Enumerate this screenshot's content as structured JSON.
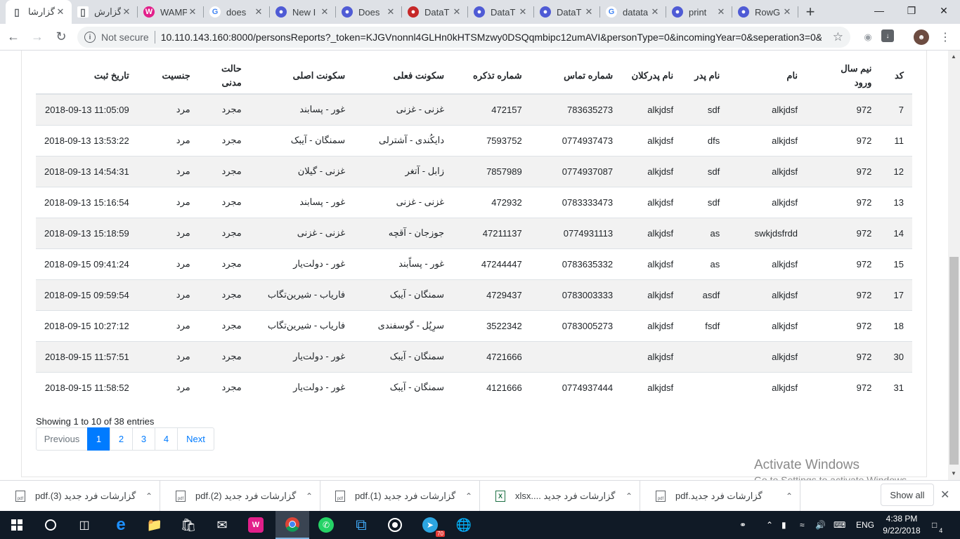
{
  "browser": {
    "tabs": [
      {
        "title": "گزارشا",
        "icon": "page-icon",
        "active": true
      },
      {
        "title": "گزارش",
        "icon": "page-icon"
      },
      {
        "title": "WAMP",
        "icon": "wamp-icon"
      },
      {
        "title": "does",
        "icon": "google-icon"
      },
      {
        "title": "New I",
        "icon": "globe-icon"
      },
      {
        "title": "Does",
        "icon": "globe-icon"
      },
      {
        "title": "DataT",
        "icon": "datatables-icon"
      },
      {
        "title": "DataT",
        "icon": "globe-icon"
      },
      {
        "title": "DataT",
        "icon": "globe-icon"
      },
      {
        "title": "datata",
        "icon": "google-icon"
      },
      {
        "title": "print",
        "icon": "globe-icon"
      },
      {
        "title": "RowG",
        "icon": "globe-icon"
      }
    ],
    "not_secure": "Not secure",
    "url": "10.110.143.160:8000/personsReports?_token=KJGVnonnl4GLHn0kHTSMzwy0DSQqmbipc12umAVI&personType=0&incomingYear=0&seperation3=0&..."
  },
  "table": {
    "headers": {
      "code": "کد",
      "entry_half_line1": "نیم سال",
      "entry_half_line2": "ورود",
      "name": "نام",
      "father": "نام پدر",
      "grandfather": "نام پدرکلان",
      "phone": "شماره تماس",
      "tazkira": "شماره تذکره",
      "current_res": "سکونت فعلی",
      "original_res": "سکونت اصلی",
      "marital_line1": "حالت",
      "marital_line2": "مدنی",
      "gender": "جنسیت",
      "reg_date": "تاریخ ثبت"
    },
    "rows": [
      {
        "code": "7",
        "half": "972",
        "name": "alkjdsf",
        "father": "sdf",
        "grandfather": "alkjdsf",
        "phone": "783635273",
        "tazkira": "472157",
        "current": "غزنی - غزنی",
        "original": "غور - پسابند",
        "marital": "مجرد",
        "gender": "مرد",
        "date": "2018-09-13 11:05:09"
      },
      {
        "code": "11",
        "half": "972",
        "name": "alkjdsf",
        "father": "dfs",
        "grandfather": "alkjdsf",
        "phone": "0774937473",
        "tazkira": "7593752",
        "current": "دایکُندی - آشترلی",
        "original": "سمنگان - آیبک",
        "marital": "مجرد",
        "gender": "مرد",
        "date": "2018-09-13 13:53:22"
      },
      {
        "code": "12",
        "half": "972",
        "name": "alkjdsf",
        "father": "sdf",
        "grandfather": "alkjdsf",
        "phone": "0774937087",
        "tazkira": "7857989",
        "current": "زابل - آتغر",
        "original": "غزنی - گیلان",
        "marital": "مجرد",
        "gender": "مرد",
        "date": "2018-09-13 14:54:31"
      },
      {
        "code": "13",
        "half": "972",
        "name": "alkjdsf",
        "father": "sdf",
        "grandfather": "alkjdsf",
        "phone": "0783333473",
        "tazkira": "472932",
        "current": "غزنی - غزنی",
        "original": "غور - پسابند",
        "marital": "مجرد",
        "gender": "مرد",
        "date": "2018-09-13 15:16:54"
      },
      {
        "code": "14",
        "half": "972",
        "name": "swkjdsfrdd",
        "father": "as",
        "grandfather": "alkjdsf",
        "phone": "0774931113",
        "tazkira": "47211137",
        "current": "جوزجان - آقچه",
        "original": "غزنی - غزنی",
        "marital": "مجرد",
        "gender": "مرد",
        "date": "2018-09-13 15:18:59"
      },
      {
        "code": "15",
        "half": "972",
        "name": "alkjdsf",
        "father": "as",
        "grandfather": "alkjdsf",
        "phone": "0783635332",
        "tazkira": "47244447",
        "current": "غور - پساًبند",
        "original": "غور - دولت‌یار",
        "marital": "مجرد",
        "gender": "مرد",
        "date": "2018-09-15 09:41:24"
      },
      {
        "code": "17",
        "half": "972",
        "name": "alkjdsf",
        "father": "asdf",
        "grandfather": "alkjdsf",
        "phone": "0783003333",
        "tazkira": "4729437",
        "current": "سمنگان - آیبک",
        "original": "فاریاب - شیرین‌تگاب",
        "marital": "مجرد",
        "gender": "مرد",
        "date": "2018-09-15 09:59:54"
      },
      {
        "code": "18",
        "half": "972",
        "name": "alkjdsf",
        "father": "fsdf",
        "grandfather": "alkjdsf",
        "phone": "0783005273",
        "tazkira": "3522342",
        "current": "سرِپُل - گوسفندی",
        "original": "فاریاب - شیرین‌تگاب",
        "marital": "مجرد",
        "gender": "مرد",
        "date": "2018-09-15 10:27:12"
      },
      {
        "code": "30",
        "half": "972",
        "name": "alkjdsf",
        "father": "",
        "grandfather": "alkjdsf",
        "phone": "",
        "tazkira": "4721666",
        "current": "سمنگان - آیبک",
        "original": "غور - دولت‌یار",
        "marital": "مجرد",
        "gender": "مرد",
        "date": "2018-09-15 11:57:51"
      },
      {
        "code": "31",
        "half": "972",
        "name": "alkjdsf",
        "father": "",
        "grandfather": "alkjdsf",
        "phone": "0774937444",
        "tazkira": "4121666",
        "current": "سمنگان - آیبک",
        "original": "غور - دولت‌یار",
        "marital": "مجرد",
        "gender": "مرد",
        "date": "2018-09-15 11:58:52"
      }
    ],
    "info": "Showing 1 to 10 of 38 entries",
    "pagination": {
      "prev": "Previous",
      "pages": [
        "1",
        "2",
        "3",
        "4"
      ],
      "current": "1",
      "next": "Next"
    }
  },
  "watermark": {
    "line1": "Activate Windows",
    "line2": "Go to Settings to activate Windows."
  },
  "downloads": {
    "items": [
      {
        "name": "گزارشات فرد جدید (3).pdf",
        "type": "pdf"
      },
      {
        "name": "گزارشات فرد جدید (2).pdf",
        "type": "pdf"
      },
      {
        "name": "گزارشات فرد جدید (1).pdf",
        "type": "pdf"
      },
      {
        "name": "گزارشات فرد جدید ....xlsx",
        "type": "xlsx"
      },
      {
        "name": "گزارشات فرد جدید.pdf",
        "type": "pdf"
      }
    ],
    "show_all": "Show all"
  },
  "taskbar": {
    "lang": "ENG",
    "time": "4:38 PM",
    "date": "9/22/2018",
    "telegram_badge": "70",
    "notif_count": "4"
  }
}
